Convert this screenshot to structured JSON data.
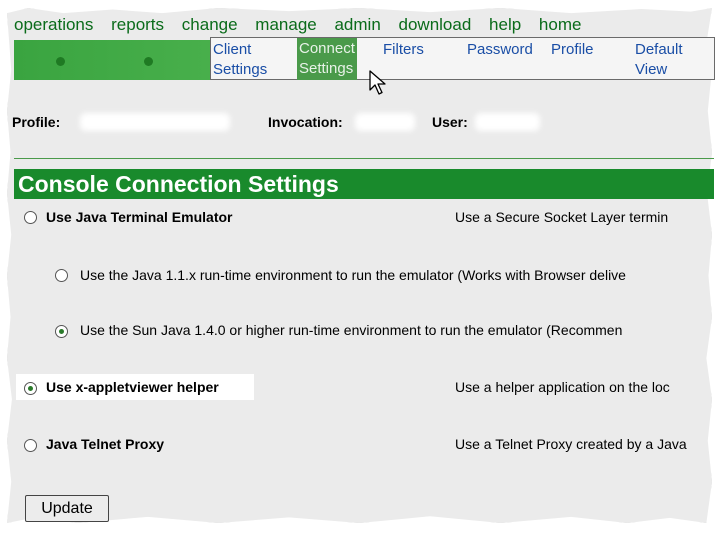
{
  "topnav": [
    "operations",
    "reports",
    "change",
    "manage",
    "admin",
    "download",
    "help",
    "home"
  ],
  "submenu": {
    "items": [
      {
        "label_line1": "Client",
        "label_line2": "Settings"
      },
      {
        "label_line1": "Connect",
        "label_line2": "Settings"
      },
      {
        "label_line1": "Filters",
        "label_line2": ""
      },
      {
        "label_line1": "Password",
        "label_line2": ""
      },
      {
        "label_line1": "Profile",
        "label_line2": ""
      },
      {
        "label_line1": "Default",
        "label_line2": "View"
      }
    ]
  },
  "info": {
    "profile_label": "Profile:",
    "invocation_label": "Invocation:",
    "user_label": "User:"
  },
  "page_title": "Console Connection Settings",
  "options": {
    "java_terminal": {
      "label": "Use Java Terminal Emulator",
      "description": "Use a Secure Socket Layer termin",
      "selected": false
    },
    "java_11": {
      "label": "Use the Java 1.1.x run-time environment to run the emulator (Works with Browser delive",
      "selected": false
    },
    "java_14": {
      "label": "Use the Sun Java 1.4.0 or higher run-time environment to run the emulator (Recommen",
      "selected": true
    },
    "appletviewer": {
      "label": "Use x-appletviewer helper",
      "description": "Use a helper application on the loc",
      "selected": true
    },
    "telnet_proxy": {
      "label": "Java Telnet Proxy",
      "description": "Use a Telnet Proxy created by a Java",
      "selected": false
    }
  },
  "update_button": "Update",
  "colors": {
    "accent_green": "#198a2c",
    "nav_text": "#0a6b1a",
    "link_blue": "#1a4ea6"
  }
}
